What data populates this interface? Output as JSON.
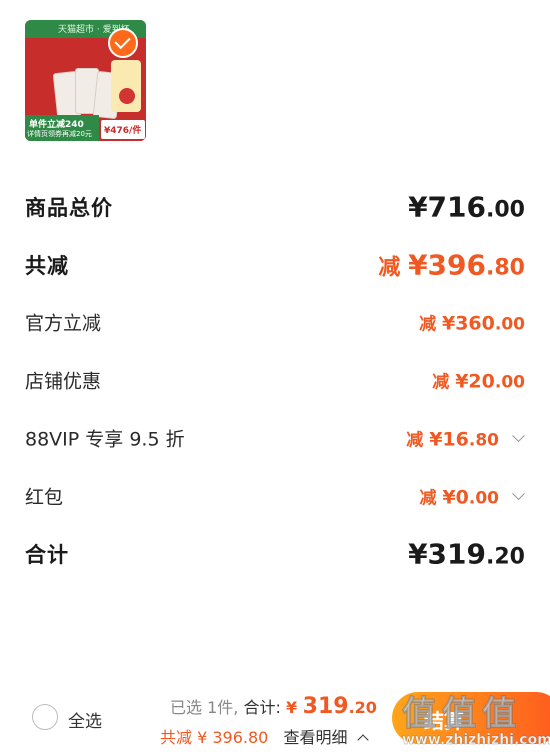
{
  "product": {
    "image_icon": "product-thumbnail-image",
    "selected": true,
    "image_texts": {
      "top": "天猫超市 · 爱到杯",
      "promo": "单件立减240",
      "coupon": "详情页领券再减20元",
      "price": "¥476/件"
    }
  },
  "price_rows": [
    {
      "label": "商品总价",
      "prefix": "",
      "int": "¥716",
      "dec": ".00",
      "style": "big",
      "color": "black"
    },
    {
      "label": "共减",
      "prefix": "减 ",
      "int": "¥396",
      "dec": ".80",
      "style": "big",
      "color": "orange"
    },
    {
      "label": "官方立减",
      "prefix": "减 ",
      "int": "¥360",
      "dec": ".00",
      "style": "norm",
      "color": "orange"
    },
    {
      "label": "店铺优惠",
      "prefix": "减 ",
      "int": "¥20",
      "dec": ".00",
      "style": "norm",
      "color": "orange"
    },
    {
      "label": "88VIP 专享 9.5 折",
      "prefix": "减 ",
      "int": "¥16",
      "dec": ".80",
      "style": "norm",
      "color": "orange",
      "chevron": true
    },
    {
      "label": "红包",
      "prefix": "减 ",
      "int": "¥0",
      "dec": ".00",
      "style": "norm",
      "color": "orange",
      "chevron": true
    },
    {
      "label": "合计",
      "prefix": "",
      "int": "¥319",
      "dec": ".20",
      "style": "big",
      "color": "black"
    }
  ],
  "bottom": {
    "select_all": "全选",
    "selected_count": "已选 1件,",
    "total_label": "合计:",
    "total_yen": "¥ ",
    "total_int": "319",
    "total_dec": ".20",
    "discount_text": "共减 ¥ 396.80",
    "view_detail": "查看明细",
    "checkout": "结算"
  },
  "watermark": {
    "logo": "值值值",
    "url": "www.zhizhizhi.com"
  },
  "colors": {
    "accent": "#f05a22",
    "checkout_start": "#ffa51a",
    "checkout_end": "#ff5a1f",
    "text": "#1a1a1a"
  }
}
